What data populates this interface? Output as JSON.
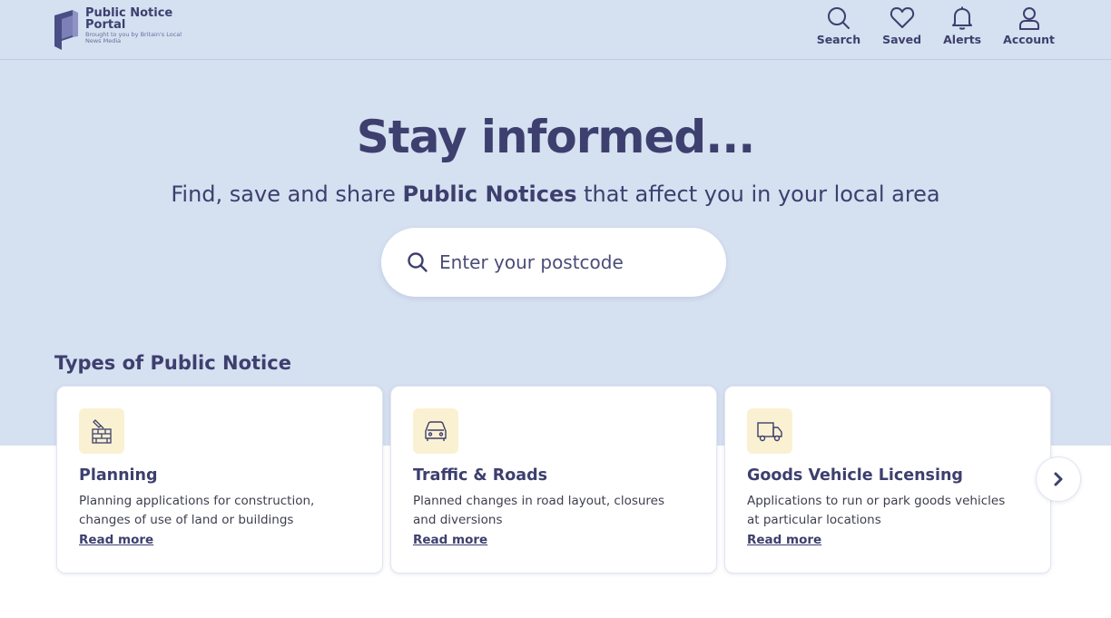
{
  "brand": {
    "title": "Public Notice Portal",
    "subtitle": "Brought to you by Britain's Local News Media"
  },
  "nav": [
    {
      "label": "Search",
      "icon": "search-icon"
    },
    {
      "label": "Saved",
      "icon": "heart-icon"
    },
    {
      "label": "Alerts",
      "icon": "bell-icon"
    },
    {
      "label": "Account",
      "icon": "user-icon"
    }
  ],
  "hero": {
    "title": "Stay informed...",
    "subtitle_before": "Find, save and share ",
    "subtitle_bold": "Public Notices",
    "subtitle_after": " that affect you in your local area",
    "search_placeholder": "Enter your postcode",
    "search_value": ""
  },
  "types": {
    "heading": "Types of Public Notice",
    "cards": [
      {
        "icon": "brick-wall-trowel-icon",
        "title": "Planning",
        "description": "Planning applications for construction, changes of use of land or buildings",
        "link": "Read more"
      },
      {
        "icon": "car-icon",
        "title": "Traffic & Roads",
        "description": "Planned changes in road layout, closures and diversions",
        "link": "Read more"
      },
      {
        "icon": "truck-icon",
        "title": "Goods Vehicle Licensing",
        "description": "Applications to run or park goods vehicles at particular locations",
        "link": "Read more"
      }
    ],
    "next_icon": "chevron-right-icon"
  },
  "colors": {
    "primary": "#3d3f6e",
    "hero_bg": "#d5e0f1",
    "icon_bg": "#faf1d2"
  }
}
